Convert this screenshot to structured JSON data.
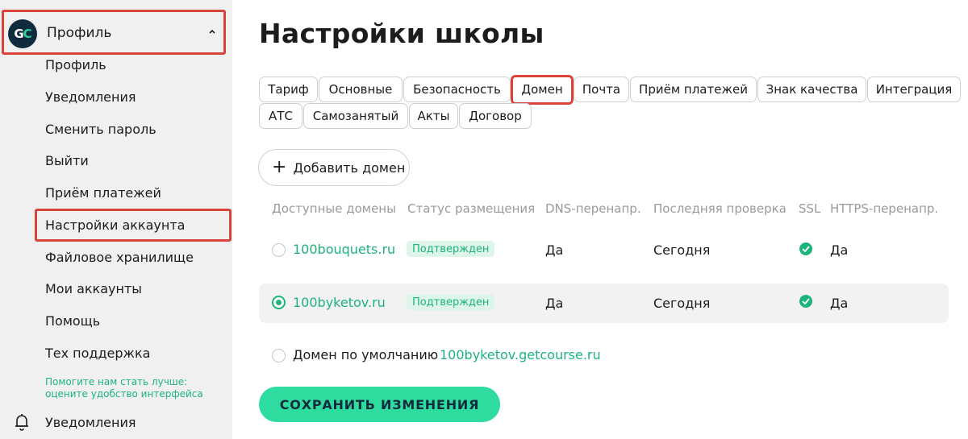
{
  "sidebar": {
    "logo": {
      "g": "G",
      "c": "C"
    },
    "profile_title": "Профиль",
    "items": [
      {
        "label": "Профиль"
      },
      {
        "label": "Уведомления"
      },
      {
        "label": "Сменить пароль"
      },
      {
        "label": "Выйти"
      },
      {
        "label": "Приём платежей"
      },
      {
        "label": "Настройки аккаунта"
      },
      {
        "label": "Файловое хранилище"
      },
      {
        "label": "Мои аккаунты"
      },
      {
        "label": "Помощь"
      },
      {
        "label": "Тех поддержка"
      }
    ],
    "feedback_line1": "Помогите нам стать лучше:",
    "feedback_line2": "оцените удобство интерфейса",
    "bottom_label": "Уведомления"
  },
  "page_title": "Настройки школы",
  "tabs": [
    {
      "label": "Тариф"
    },
    {
      "label": "Основные"
    },
    {
      "label": "Безопасность"
    },
    {
      "label": "Домен",
      "active": true
    },
    {
      "label": "Почта"
    },
    {
      "label": "Приём платежей"
    },
    {
      "label": "Знак качества"
    },
    {
      "label": "Интеграция"
    },
    {
      "label": "АТС"
    },
    {
      "label": "Самозанятый"
    },
    {
      "label": "Акты"
    },
    {
      "label": "Договор"
    }
  ],
  "add_domain_label": "Добавить домен",
  "table": {
    "headers": [
      "Доступные домены",
      "Статус размещения",
      "DNS-перенапр.",
      "Последняя проверка",
      "SSL",
      "HTTPS-перенапр."
    ],
    "rows": [
      {
        "domain": "100bouquets.ru",
        "status": "Подтвержден",
        "dns": "Да",
        "last_check": "Сегодня",
        "ssl": true,
        "https": "Да",
        "selected": false
      },
      {
        "domain": "100byketov.ru",
        "status": "Подтвержден",
        "dns": "Да",
        "last_check": "Сегодня",
        "ssl": true,
        "https": "Да",
        "selected": true
      }
    ]
  },
  "default_domain": {
    "label": "Домен по умолчанию",
    "value": "100byketov.getcourse.ru",
    "selected": false
  },
  "save_label": "СОХРАНИТЬ ИЗМЕНЕНИЯ",
  "colors": {
    "accent": "#1cb47a",
    "button": "#2fdca0",
    "highlight": "#d9433a",
    "sidebar_bg": "#f0f0f0"
  }
}
